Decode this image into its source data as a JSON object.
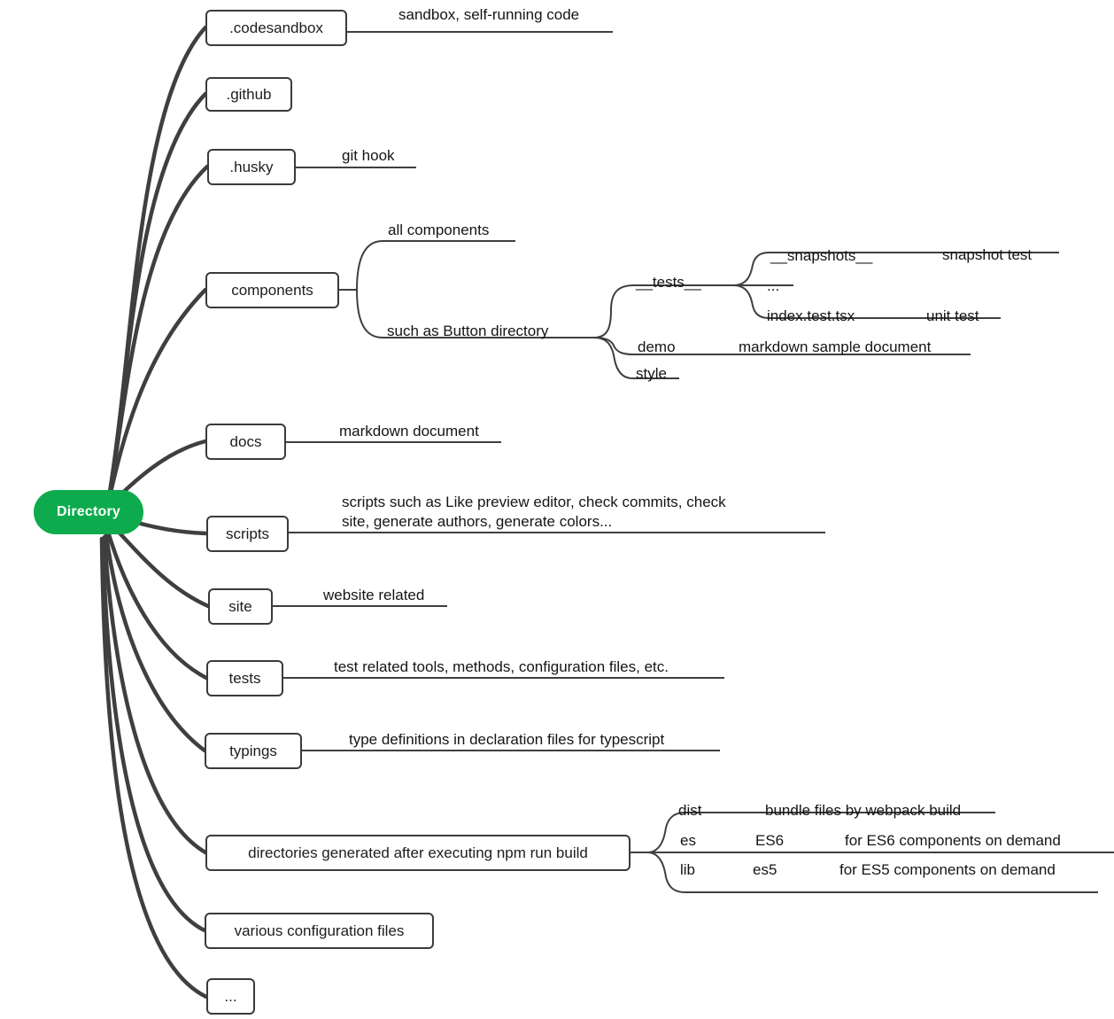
{
  "diagram": {
    "type": "mindmap",
    "title": "Directory",
    "root": {
      "label": "Directory",
      "color": "#0EAB4E",
      "text_color": "#ffffff"
    },
    "branches": [
      {
        "key": "codesandbox",
        "label": ".codesandbox",
        "note": "sandbox, self-running code"
      },
      {
        "key": "github",
        "label": ".github",
        "note": ""
      },
      {
        "key": "husky",
        "label": ".husky",
        "note": "git hook"
      },
      {
        "key": "components",
        "label": "components",
        "sub": [
          {
            "key": "all-components",
            "label": "all components"
          },
          {
            "key": "button-directory",
            "label": "such as  Button directory",
            "sub": [
              {
                "key": "tests",
                "label": "__tests__",
                "sub": [
                  {
                    "key": "snapshots",
                    "label": "__snapshots__",
                    "note": "snapshot test"
                  },
                  {
                    "key": "ellipsis",
                    "label": "...",
                    "note": ""
                  },
                  {
                    "key": "index-test-tsx",
                    "label": "index.test.tsx",
                    "note": "unit test"
                  }
                ]
              },
              {
                "key": "demo",
                "label": "demo",
                "note": "markdown sample document"
              },
              {
                "key": "style",
                "label": "style",
                "note": ""
              }
            ]
          }
        ]
      },
      {
        "key": "docs",
        "label": "docs",
        "note": "markdown document"
      },
      {
        "key": "scripts",
        "label": "scripts",
        "note_line1": "scripts such as  Like preview editor, check commits, check",
        "note_line2": "site, generate authors, generate colors..."
      },
      {
        "key": "site",
        "label": "site",
        "note": "website related"
      },
      {
        "key": "tests",
        "label": "tests",
        "note": "test related tools, methods, configuration files, etc."
      },
      {
        "key": "typings",
        "label": "typings",
        "note": "type definitions in declaration files for typescript"
      },
      {
        "key": "build-output",
        "label": "directories generated after executing npm run build",
        "sub": [
          {
            "key": "dist",
            "label": "dist",
            "note": "bundle files by webpack build"
          },
          {
            "key": "es",
            "label": "es",
            "mid": "ES6",
            "note": "for ES6 components on demand"
          },
          {
            "key": "lib",
            "label": "lib",
            "mid": "es5",
            "note": "for ES5 components on demand"
          }
        ]
      },
      {
        "key": "config-files",
        "label": "various configuration files",
        "note": ""
      },
      {
        "key": "more",
        "label": "...",
        "note": ""
      }
    ]
  }
}
